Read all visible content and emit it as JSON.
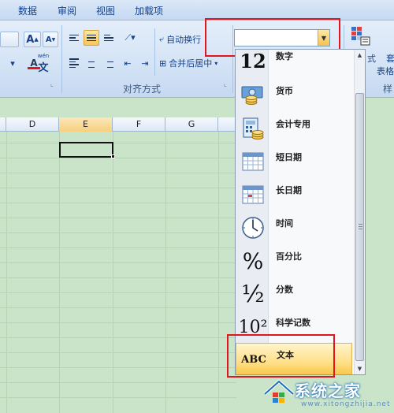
{
  "menu": {
    "tabs": [
      "数据",
      "审阅",
      "视图",
      "加载项"
    ]
  },
  "ribbon": {
    "increase_font_label": "A",
    "decrease_font_label": "A",
    "font_color_label": "A",
    "phonetic_label": "文",
    "phonetic_top": "wén",
    "wrap_text_label": "自动换行",
    "merge_center_label": "合并后居中",
    "alignment_group_label": "对齐方式",
    "right_partial": {
      "style_text": "式",
      "table_text": "表格",
      "extra_text": "套",
      "group_label": "样"
    }
  },
  "grid": {
    "columns": [
      "D",
      "E",
      "F",
      "G"
    ],
    "selected_column": "E"
  },
  "format_combo": {
    "value": ""
  },
  "format_list": {
    "items": [
      {
        "label": "数字",
        "icon": "number-12-icon",
        "icon_text": "12"
      },
      {
        "label": "货币",
        "icon": "currency-icon"
      },
      {
        "label": "会计专用",
        "icon": "accounting-icon"
      },
      {
        "label": "短日期",
        "icon": "short-date-icon"
      },
      {
        "label": "长日期",
        "icon": "long-date-icon"
      },
      {
        "label": "时间",
        "icon": "clock-icon"
      },
      {
        "label": "百分比",
        "icon": "percent-icon",
        "icon_text": "%"
      },
      {
        "label": "分数",
        "icon": "fraction-icon",
        "icon_text": "½"
      },
      {
        "label": "科学记数",
        "icon": "scientific-icon",
        "icon_text": "10²"
      },
      {
        "label": "文本",
        "icon": "text-abc-icon",
        "icon_text": "ABC"
      }
    ],
    "selected": "文本"
  },
  "watermark": {
    "text": "系统之家",
    "url": "www.xitongzhijia.net"
  },
  "colors": {
    "highlight_red": "#e0151e",
    "selection_gold": "#f9c84d",
    "sheet_green": "#c9e4c9"
  }
}
